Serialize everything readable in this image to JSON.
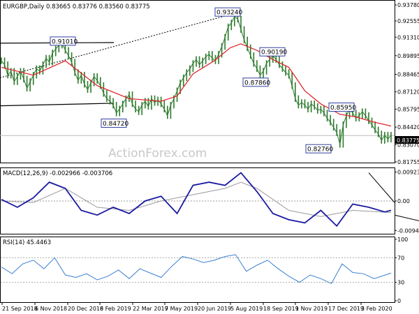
{
  "chart_data": [
    {
      "type": "candlestick",
      "title": "EURGBP,Daily  0.83665 0.83776 0.83560 0.83775",
      "ylim": [
        0.817,
        0.94
      ],
      "y_ticks": [
        "0.93780",
        "0.92555",
        "0.91310",
        "0.89895",
        "0.88465",
        "0.87120",
        "0.85795",
        "0.84420",
        "0.83070",
        "0.81755"
      ],
      "last_price_label": "0.83775",
      "last_price": 0.83775,
      "series": [
        {
          "name": "Close",
          "points": [
            [
              0,
              0.895
            ],
            [
              3,
              0.892
            ],
            [
              6,
              0.884
            ],
            [
              9,
              0.887
            ],
            [
              12,
              0.879
            ],
            [
              15,
              0.883
            ],
            [
              18,
              0.887
            ],
            [
              21,
              0.881
            ],
            [
              24,
              0.874
            ],
            [
              27,
              0.879
            ],
            [
              30,
              0.884
            ],
            [
              33,
              0.889
            ],
            [
              36,
              0.887
            ],
            [
              39,
              0.892
            ],
            [
              42,
              0.897
            ],
            [
              45,
              0.894
            ],
            [
              48,
              0.901
            ],
            [
              51,
              0.904
            ],
            [
              54,
              0.907
            ],
            [
              57,
              0.909
            ],
            [
              60,
              0.903
            ],
            [
              63,
              0.899
            ],
            [
              66,
              0.894
            ],
            [
              69,
              0.886
            ],
            [
              72,
              0.88
            ],
            [
              75,
              0.884
            ],
            [
              78,
              0.877
            ],
            [
              81,
              0.873
            ],
            [
              84,
              0.878
            ],
            [
              87,
              0.883
            ],
            [
              90,
              0.88
            ],
            [
              93,
              0.876
            ],
            [
              96,
              0.87
            ],
            [
              99,
              0.866
            ],
            [
              102,
              0.864
            ],
            [
              105,
              0.861
            ],
            [
              108,
              0.855
            ],
            [
              111,
              0.858
            ],
            [
              114,
              0.862
            ],
            [
              117,
              0.866
            ],
            [
              120,
              0.869
            ],
            [
              123,
              0.862
            ],
            [
              126,
              0.858
            ],
            [
              129,
              0.856
            ],
            [
              132,
              0.861
            ],
            [
              135,
              0.864
            ],
            [
              138,
              0.86
            ],
            [
              141,
              0.866
            ],
            [
              144,
              0.863
            ],
            [
              147,
              0.865
            ],
            [
              150,
              0.862
            ],
            [
              153,
              0.858
            ],
            [
              156,
              0.853
            ],
            [
              159,
              0.861
            ],
            [
              162,
              0.866
            ],
            [
              165,
              0.872
            ],
            [
              168,
              0.878
            ],
            [
              171,
              0.882
            ],
            [
              174,
              0.886
            ],
            [
              177,
              0.889
            ],
            [
              180,
              0.893
            ],
            [
              183,
              0.896
            ],
            [
              186,
              0.892
            ],
            [
              189,
              0.895
            ],
            [
              192,
              0.898
            ],
            [
              195,
              0.9
            ],
            [
              198,
              0.897
            ],
            [
              201,
              0.895
            ],
            [
              204,
              0.9
            ],
            [
              207,
              0.906
            ],
            [
              210,
              0.913
            ],
            [
              213,
              0.921
            ],
            [
              216,
              0.924
            ],
            [
              219,
              0.929
            ],
            [
              222,
              0.927
            ],
            [
              225,
              0.919
            ],
            [
              228,
              0.911
            ],
            [
              231,
              0.905
            ],
            [
              234,
              0.899
            ],
            [
              237,
              0.893
            ],
            [
              240,
              0.889
            ],
            [
              243,
              0.884
            ],
            [
              246,
              0.887
            ],
            [
              249,
              0.893
            ],
            [
              252,
              0.896
            ],
            [
              255,
              0.899
            ],
            [
              258,
              0.896
            ],
            [
              261,
              0.892
            ],
            [
              264,
              0.889
            ],
            [
              267,
              0.886
            ],
            [
              270,
              0.884
            ],
            [
              273,
              0.876
            ],
            [
              276,
              0.866
            ],
            [
              279,
              0.861
            ],
            [
              282,
              0.863
            ],
            [
              285,
              0.861
            ],
            [
              288,
              0.858
            ],
            [
              291,
              0.862
            ],
            [
              294,
              0.86
            ],
            [
              297,
              0.857
            ],
            [
              300,
              0.858
            ],
            [
              303,
              0.855
            ],
            [
              306,
              0.851
            ],
            [
              309,
              0.848
            ],
            [
              312,
              0.844
            ],
            [
              315,
              0.84
            ],
            [
              318,
              0.831
            ],
            [
              321,
              0.846
            ],
            [
              324,
              0.853
            ],
            [
              327,
              0.858
            ],
            [
              330,
              0.855
            ],
            [
              333,
              0.851
            ],
            [
              336,
              0.853
            ],
            [
              339,
              0.856
            ],
            [
              342,
              0.853
            ],
            [
              345,
              0.849
            ],
            [
              348,
              0.846
            ],
            [
              351,
              0.842
            ],
            [
              354,
              0.839
            ],
            [
              357,
              0.834
            ],
            [
              360,
              0.838
            ],
            [
              363,
              0.835
            ],
            [
              366,
              0.838
            ]
          ]
        },
        {
          "name": "MA",
          "points": [
            [
              0,
              0.89
            ],
            [
              30,
              0.884
            ],
            [
              60,
              0.895
            ],
            [
              90,
              0.876
            ],
            [
              120,
              0.866
            ],
            [
              150,
              0.864
            ],
            [
              165,
              0.868
            ],
            [
              180,
              0.885
            ],
            [
              200,
              0.895
            ],
            [
              215,
              0.905
            ],
            [
              225,
              0.908
            ],
            [
              240,
              0.903
            ],
            [
              255,
              0.896
            ],
            [
              270,
              0.89
            ],
            [
              285,
              0.872
            ],
            [
              300,
              0.862
            ],
            [
              318,
              0.854
            ],
            [
              333,
              0.852
            ],
            [
              350,
              0.848
            ],
            [
              366,
              0.845
            ]
          ]
        }
      ],
      "labels": [
        "0.93240",
        "0.91010",
        "0.90190",
        "0.87860",
        "0.84720",
        "0.85950",
        "0.82760"
      ],
      "trendlines": 4
    },
    {
      "type": "line",
      "title": "MACD(12,26,9) -0.002966 -0.003706",
      "y_ticks": [
        "0.009237",
        "0.00",
        "-0.009413"
      ],
      "ylim": [
        -0.0098,
        0.0098
      ],
      "series": [
        {
          "name": "MACD",
          "points": [
            [
              0,
              0.0005
            ],
            [
              15,
              -0.002
            ],
            [
              30,
              0.001
            ],
            [
              45,
              0.006
            ],
            [
              60,
              0.004
            ],
            [
              75,
              -0.003
            ],
            [
              90,
              -0.0045
            ],
            [
              105,
              -0.002
            ],
            [
              120,
              -0.004
            ],
            [
              135,
              0.0
            ],
            [
              150,
              0.0015
            ],
            [
              165,
              -0.004
            ],
            [
              180,
              0.005
            ],
            [
              195,
              0.006
            ],
            [
              210,
              0.005
            ],
            [
              225,
              0.009
            ],
            [
              240,
              0.003
            ],
            [
              255,
              -0.004
            ],
            [
              270,
              -0.006
            ],
            [
              285,
              -0.007
            ],
            [
              300,
              -0.003
            ],
            [
              315,
              -0.008
            ],
            [
              330,
              -0.001
            ],
            [
              345,
              -0.002
            ],
            [
              360,
              -0.0035
            ],
            [
              366,
              -0.003
            ]
          ]
        },
        {
          "name": "Signal",
          "points": [
            [
              0,
              0.0
            ],
            [
              30,
              -0.0005
            ],
            [
              60,
              0.004
            ],
            [
              90,
              -0.002
            ],
            [
              120,
              -0.003
            ],
            [
              150,
              0.0
            ],
            [
              180,
              0.002
            ],
            [
              210,
              0.004
            ],
            [
              225,
              0.006
            ],
            [
              240,
              0.004
            ],
            [
              270,
              -0.003
            ],
            [
              300,
              -0.005
            ],
            [
              330,
              -0.003
            ],
            [
              366,
              -0.0037
            ]
          ]
        }
      ]
    },
    {
      "type": "line",
      "title": "RSI(14) 45.4463",
      "y_ticks": [
        "100",
        "70",
        "30",
        "0"
      ],
      "ylim": [
        0,
        100
      ],
      "series": [
        {
          "name": "RSI",
          "points": [
            [
              0,
              55
            ],
            [
              10,
              44
            ],
            [
              20,
              60
            ],
            [
              30,
              66
            ],
            [
              40,
              52
            ],
            [
              50,
              70
            ],
            [
              60,
              42
            ],
            [
              70,
              38
            ],
            [
              80,
              44
            ],
            [
              90,
              34
            ],
            [
              100,
              40
            ],
            [
              110,
              50
            ],
            [
              120,
              36
            ],
            [
              130,
              52
            ],
            [
              140,
              45
            ],
            [
              150,
              38
            ],
            [
              160,
              56
            ],
            [
              170,
              72
            ],
            [
              180,
              68
            ],
            [
              190,
              62
            ],
            [
              200,
              66
            ],
            [
              210,
              72
            ],
            [
              220,
              75
            ],
            [
              230,
              48
            ],
            [
              240,
              58
            ],
            [
              250,
              66
            ],
            [
              260,
              52
            ],
            [
              270,
              40
            ],
            [
              280,
              30
            ],
            [
              290,
              42
            ],
            [
              300,
              36
            ],
            [
              310,
              28
            ],
            [
              320,
              60
            ],
            [
              330,
              46
            ],
            [
              340,
              44
            ],
            [
              350,
              36
            ],
            [
              366,
              45
            ]
          ]
        }
      ]
    }
  ],
  "x_labels": [
    "21 Sep 2018",
    "6 Nov 2018",
    "20 Dec 2018",
    "6 Feb 2019",
    "22 Mar 2019",
    "7 May 2019",
    "20 Jun 2019",
    "5 Aug 2019",
    "18 Sep 2019",
    "1 Nov 2019",
    "17 Dec 2019",
    "3 Feb 2020"
  ],
  "watermark": "ActionForex.com",
  "colors": {
    "price": "#2c7a2c",
    "ma": "#e0262b",
    "macd": "#1a1aa0",
    "signal": "#9a9a9a",
    "rsi": "#3a7fd0",
    "trend": "#000000",
    "grid": "#cccccc"
  }
}
